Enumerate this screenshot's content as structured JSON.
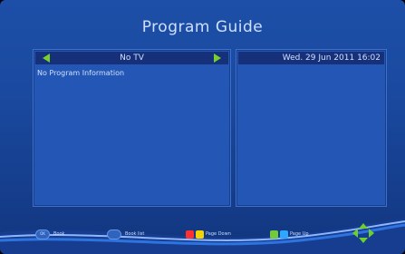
{
  "app": {
    "title": "Program Guide"
  },
  "left_panel": {
    "channel": "No TV",
    "message": "No Program Information"
  },
  "right_panel": {
    "datetime": "Wed.  29 Jun 2011 16:02"
  },
  "footer": {
    "ok_label": "OK",
    "book_label": "Book",
    "book_list_label": "Book list",
    "page_down_label": "Page Down",
    "page_up_label": "Page Up"
  },
  "colors": {
    "red": "#ff3030",
    "yellow": "#f4d400",
    "green": "#72c93a",
    "blue": "#2da8ff"
  }
}
